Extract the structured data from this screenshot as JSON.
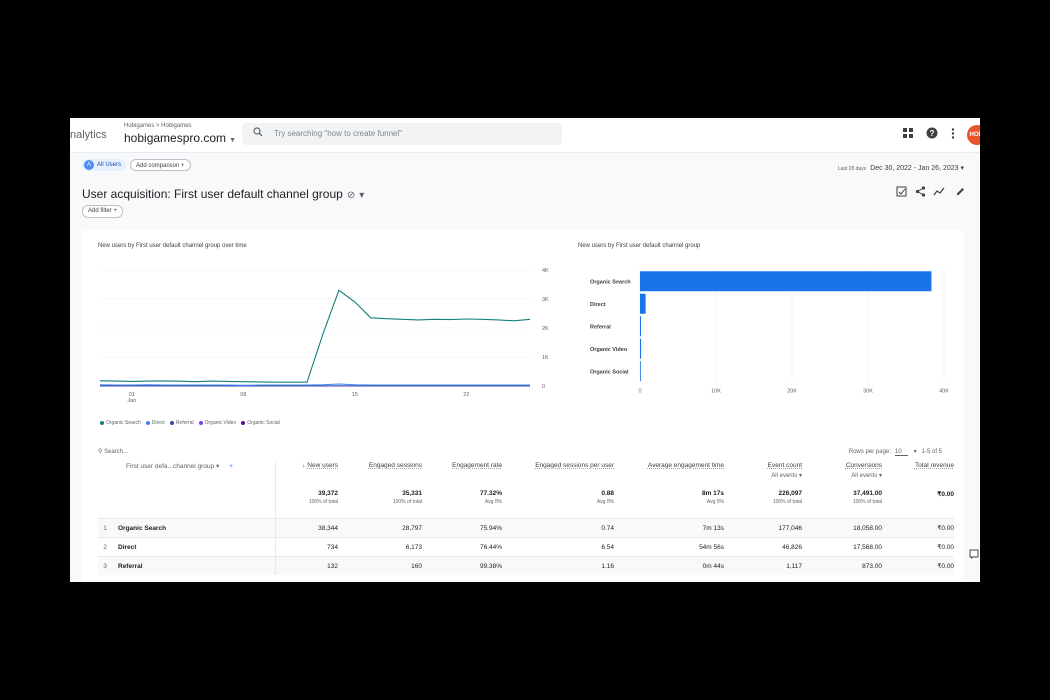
{
  "app": {
    "product_fragment": "nalytics",
    "breadcrumb": "Hobigames > Hobigames",
    "property": "hobigamespro.com"
  },
  "search": {
    "placeholder": "Try searching \"how to create funnel\""
  },
  "comparison": {
    "segment_badge": "A",
    "segment": "All Users",
    "add_comparison": "Add comparison"
  },
  "date_range": {
    "label": "Last 28 days",
    "value": "Dec 30, 2022 - Jan 26, 2023"
  },
  "report": {
    "title": "User acquisition: First user default channel group",
    "add_filter": "Add filter"
  },
  "avatar_text": "HOBI",
  "colors": {
    "accent": "#1a73e8",
    "organic_search": "#12807c",
    "direct": "#4285f4",
    "referral": "#3949ab",
    "organic_video": "#7b3fe4",
    "organic_social": "#4a148c"
  },
  "chart_data": [
    {
      "type": "line",
      "title": "New users by First user default channel group over time",
      "x_ticks": [
        "01\nJan",
        "08",
        "15",
        "22"
      ],
      "y_ticks": [
        "0",
        "1K",
        "2K",
        "3K",
        "4K"
      ],
      "ylim": [
        0,
        4000
      ],
      "x": [
        "Dec 30",
        "Dec 31",
        "Jan 1",
        "Jan 2",
        "Jan 3",
        "Jan 4",
        "Jan 5",
        "Jan 6",
        "Jan 7",
        "Jan 8",
        "Jan 9",
        "Jan 10",
        "Jan 11",
        "Jan 12",
        "Jan 13",
        "Jan 14",
        "Jan 15",
        "Jan 16",
        "Jan 17",
        "Jan 18",
        "Jan 19",
        "Jan 20",
        "Jan 21",
        "Jan 22",
        "Jan 23",
        "Jan 24",
        "Jan 25",
        "Jan 26"
      ],
      "series": [
        {
          "name": "Organic Search",
          "color": "#12807c",
          "values": [
            180,
            170,
            160,
            170,
            175,
            165,
            150,
            170,
            160,
            150,
            140,
            130,
            130,
            130,
            1800,
            3300,
            2900,
            2350,
            2320,
            2300,
            2280,
            2300,
            2290,
            2310,
            2300,
            2280,
            2250,
            2300
          ]
        },
        {
          "name": "Direct",
          "color": "#4285f4",
          "values": [
            40,
            35,
            30,
            40,
            35,
            30,
            30,
            35,
            30,
            25,
            30,
            30,
            35,
            30,
            40,
            70,
            40,
            35,
            30,
            30,
            30,
            30,
            35,
            30,
            30,
            30,
            30,
            30
          ]
        },
        {
          "name": "Referral",
          "color": "#3949ab",
          "values": [
            8,
            6,
            5,
            6,
            5,
            5,
            4,
            5,
            4,
            5,
            4,
            4,
            5,
            4,
            5,
            6,
            5,
            5,
            4,
            5,
            5,
            4,
            5,
            4,
            5,
            4,
            5,
            4
          ]
        },
        {
          "name": "Organic Video",
          "color": "#7b3fe4",
          "values": [
            1,
            1,
            0,
            1,
            1,
            0,
            1,
            0,
            1,
            1,
            0,
            1,
            1,
            0,
            1,
            1,
            0,
            1,
            0,
            1,
            1,
            0,
            1,
            0,
            1,
            1,
            0,
            1
          ]
        },
        {
          "name": "Organic Social",
          "color": "#4a148c",
          "values": [
            0,
            0,
            0,
            0,
            0,
            0,
            0,
            0,
            0,
            0,
            0,
            0,
            0,
            0,
            0,
            0,
            0,
            0,
            0,
            0,
            0,
            0,
            0,
            0,
            0,
            0,
            0,
            0
          ]
        }
      ],
      "legend_position": "bottom"
    },
    {
      "type": "bar",
      "orientation": "horizontal",
      "title": "New users by First user default channel group",
      "categories": [
        "Organic Search",
        "Direct",
        "Referral",
        "Organic Video",
        "Organic Social"
      ],
      "values": [
        38344,
        734,
        132,
        140,
        22
      ],
      "x_ticks": [
        "0",
        "10K",
        "20K",
        "30K",
        "40K"
      ],
      "xlim": [
        0,
        40000
      ],
      "color": "#1a73e8"
    }
  ],
  "table": {
    "search_placeholder": "Search...",
    "rows_per_page_label": "Rows per page:",
    "rows_per_page": "10",
    "range": "1-5 of 5",
    "dimension_header": "First user defa...channel group",
    "columns": [
      {
        "label": "New users",
        "sub": "",
        "total": "39,372",
        "total_sub": "100% of total"
      },
      {
        "label": "Engaged sessions",
        "sub": "",
        "total": "35,331",
        "total_sub": "100% of total"
      },
      {
        "label": "Engagement rate",
        "sub": "",
        "total": "77.32%",
        "total_sub": "Avg 0%"
      },
      {
        "label": "Engaged sessions per user",
        "sub": "",
        "total": "0.88",
        "total_sub": "Avg 0%"
      },
      {
        "label": "Average engagement time",
        "sub": "",
        "total": "8m 17s",
        "total_sub": "Avg 0%"
      },
      {
        "label": "Event count",
        "sub": "All events",
        "total": "226,097",
        "total_sub": "100% of total"
      },
      {
        "label": "Conversions",
        "sub": "All events",
        "total": "37,491.00",
        "total_sub": "100% of total"
      },
      {
        "label": "Total revenue",
        "sub": "",
        "total": "₹0.00",
        "total_sub": ""
      }
    ],
    "rows": [
      {
        "idx": "1",
        "name": "Organic Search",
        "vals": [
          "38,344",
          "28,797",
          "75.94%",
          "0.74",
          "7m 13s",
          "177,046",
          "18,058.00",
          "₹0.00"
        ]
      },
      {
        "idx": "2",
        "name": "Direct",
        "vals": [
          "734",
          "6,173",
          "76.44%",
          "6.54",
          "54m 56s",
          "46,826",
          "17,568.00",
          "₹0.00"
        ]
      },
      {
        "idx": "3",
        "name": "Referral",
        "vals": [
          "132",
          "160",
          "99.38%",
          "1.16",
          "0m 44s",
          "1,117",
          "873.00",
          "₹0.00"
        ]
      }
    ]
  }
}
